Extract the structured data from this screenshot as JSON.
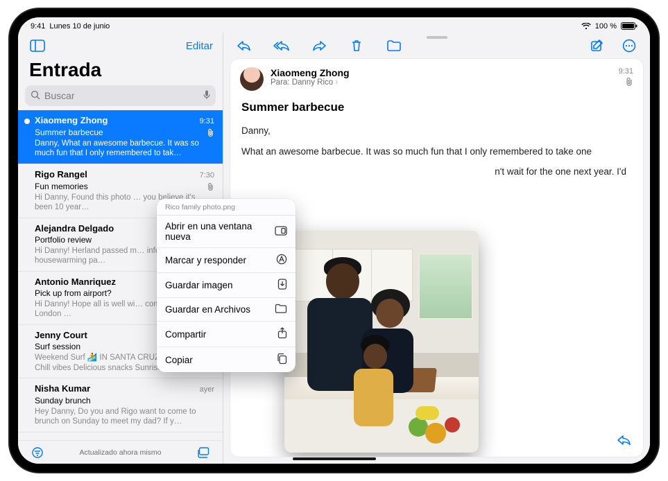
{
  "status": {
    "time": "9:41",
    "date": "Lunes 10 de junio",
    "battery": "100 %"
  },
  "sidebar": {
    "edit": "Editar",
    "title": "Entrada",
    "search_placeholder": "Buscar",
    "footer_status": "Actualizado ahora mismo"
  },
  "messages": [
    {
      "from": "Xiaomeng Zhong",
      "time": "9:31",
      "subject": "Summer barbecue",
      "preview": "Danny, What an awesome barbecue. It was so much fun that I only remembered to tak…",
      "selected": true,
      "unread": true,
      "attachment": true
    },
    {
      "from": "Rigo Rangel",
      "time": "7:30",
      "subject": "Fun memories",
      "preview": "Hi Danny, Found this photo … you believe it's been 10 year…",
      "attachment": true
    },
    {
      "from": "Alejandra Delgado",
      "time": "",
      "subject": "Portfolio review",
      "preview": "Hi Danny! Herland passed m… info at his housewarming pa…"
    },
    {
      "from": "Antonio Manriquez",
      "time": "",
      "subject": "Pick up from airport?",
      "preview": "Hi Danny! Hope all is well wi… coming home from London …"
    },
    {
      "from": "Jenny Court",
      "time": "",
      "subject": "Surf session",
      "preview": "Weekend Surf 🏄 IN SANTA CRUZ Glassy waves Chill vibes Delicious snacks Sunrise…"
    },
    {
      "from": "Nisha Kumar",
      "time": "ayer",
      "subject": "Sunday brunch",
      "preview": "Hey Danny, Do you and Rigo want to come to brunch on Sunday to meet my dad? If y…"
    }
  ],
  "reader": {
    "from": "Xiaomeng Zhong",
    "to_label": "Para:",
    "to_name": "Danny Rico",
    "time": "9:31",
    "subject": "Summer barbecue",
    "greeting": "Danny,",
    "para1": "What an awesome barbecue. It was so much fun that I only remembered to take one",
    "para2_tail": "n't wait for the one next year. I'd"
  },
  "context_menu": {
    "filename": "Rico family photo.png",
    "items": [
      {
        "label": "Abrir en una ventana nueva",
        "icon": "window-new"
      },
      {
        "label": "Marcar y responder",
        "icon": "markup"
      },
      {
        "label": "Guardar imagen",
        "icon": "download"
      },
      {
        "label": "Guardar en Archivos",
        "icon": "folder"
      },
      {
        "label": "Compartir",
        "icon": "share"
      },
      {
        "label": "Copiar",
        "icon": "copy"
      }
    ]
  }
}
